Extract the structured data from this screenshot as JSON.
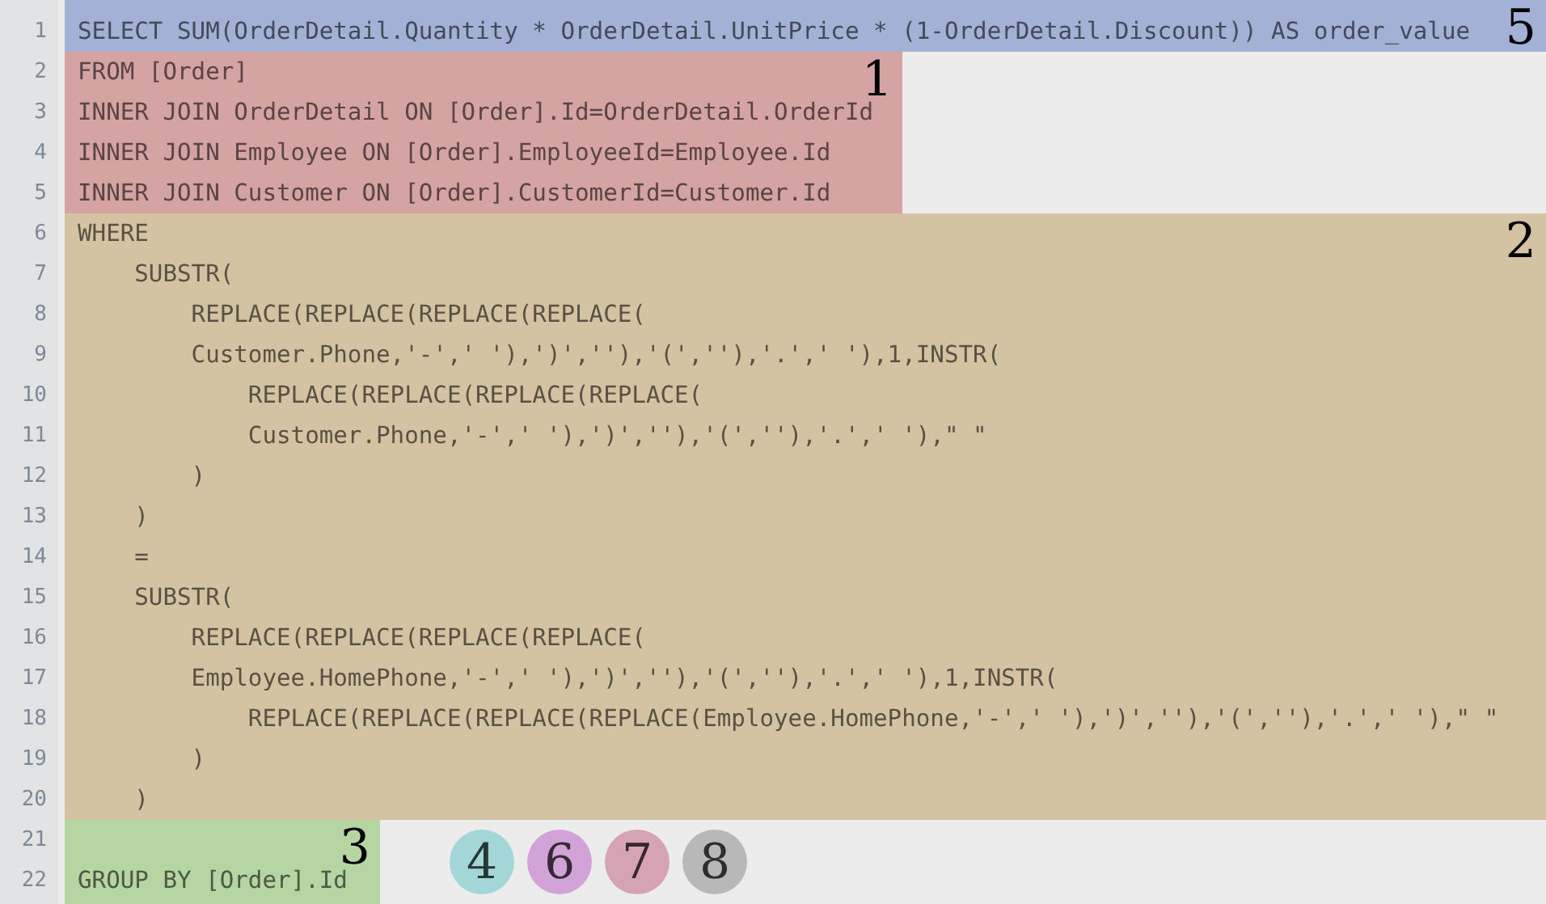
{
  "line_numbers": [
    "1",
    "2",
    "3",
    "4",
    "5",
    "6",
    "7",
    "8",
    "9",
    "10",
    "11",
    "12",
    "13",
    "14",
    "15",
    "16",
    "17",
    "18",
    "19",
    "20",
    "21",
    "22"
  ],
  "blocks": [
    {
      "label": "5",
      "color": "#a3b1d6",
      "full_width": true,
      "lines": [
        "SELECT SUM(OrderDetail.Quantity * OrderDetail.UnitPrice * (1-OrderDetail.Discount)) AS order_value"
      ]
    },
    {
      "label": "1",
      "color": "#d6a3a3",
      "full_width": false,
      "lines": [
        "FROM [Order]",
        "INNER JOIN OrderDetail ON [Order].Id=OrderDetail.OrderId",
        "INNER JOIN Employee ON [Order].EmployeeId=Employee.Id",
        "INNER JOIN Customer ON [Order].CustomerId=Customer.Id"
      ]
    },
    {
      "label": "2",
      "color": "#d4c3a3",
      "full_width": true,
      "lines": [
        "WHERE",
        "    SUBSTR(",
        "        REPLACE(REPLACE(REPLACE(REPLACE(",
        "        Customer.Phone,'-',' '),')',''),'(',''),'.',' '),1,INSTR(",
        "            REPLACE(REPLACE(REPLACE(REPLACE(",
        "            Customer.Phone,'-',' '),')',''),'(',''),'.',' '),\" \"",
        "        )",
        "    )",
        "    =",
        "    SUBSTR(",
        "        REPLACE(REPLACE(REPLACE(REPLACE(",
        "        Employee.HomePhone,'-',' '),')',''),'(',''),'.',' '),1,INSTR(",
        "            REPLACE(REPLACE(REPLACE(REPLACE(Employee.HomePhone,'-',' '),')',''),'(',''),'.',' '),\" \"",
        "        )",
        "    )"
      ]
    }
  ],
  "group_block": {
    "label": "3",
    "color": "#b5d6a3",
    "line": "GROUP BY [Order].Id"
  },
  "circles": [
    {
      "label": "4",
      "color": "#a3d6d6"
    },
    {
      "label": "6",
      "color": "#d2a3d6"
    },
    {
      "label": "7",
      "color": "#d6a3b4"
    },
    {
      "label": "8",
      "color": "#b8b8b8"
    }
  ]
}
